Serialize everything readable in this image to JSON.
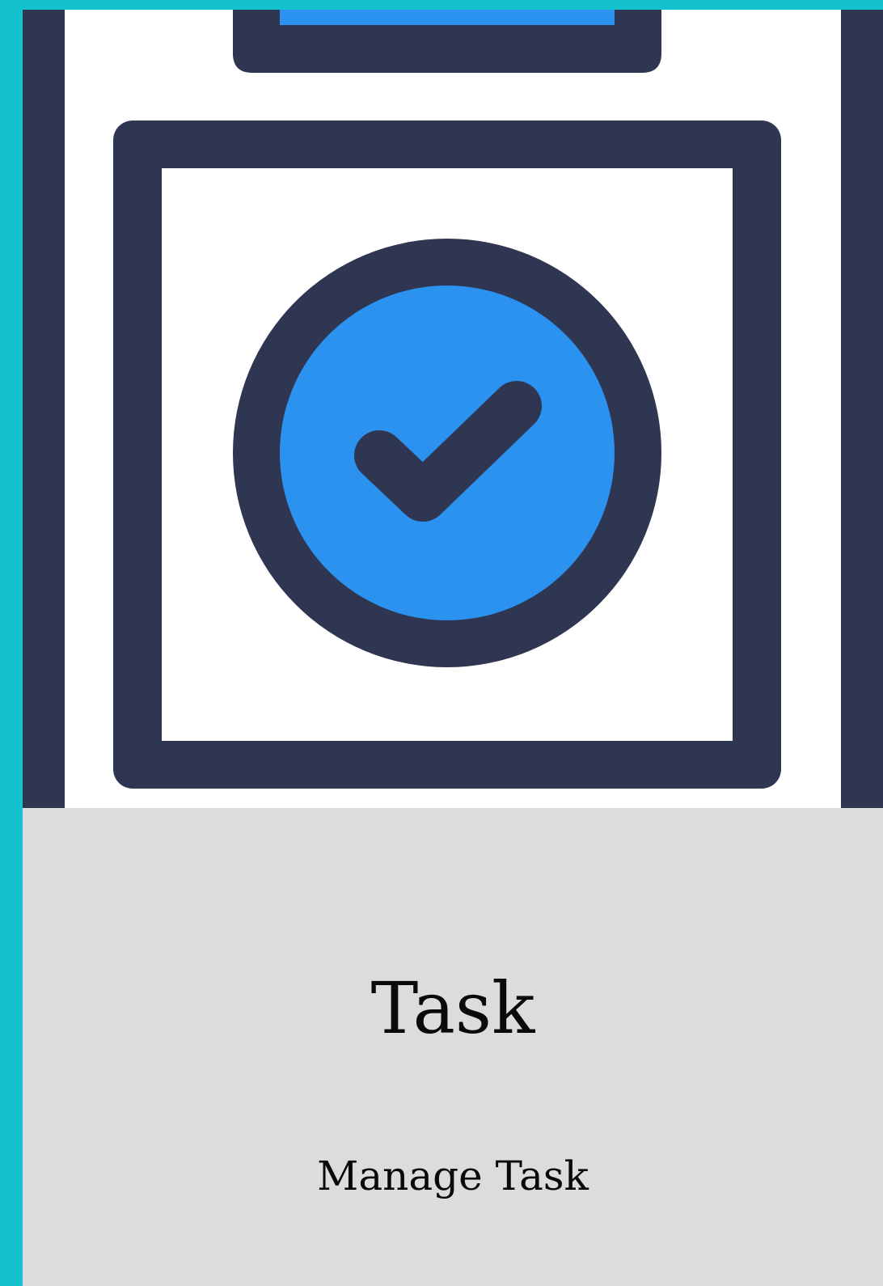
{
  "card": {
    "title": "Task",
    "subtitle": "Manage Task"
  },
  "illustration": {
    "icon": "task-check-icon",
    "colors": {
      "outline": "#2F3652",
      "fill": "#2B92F0",
      "background": "#FFFFFF"
    }
  },
  "colors": {
    "page_background": "#14C1CF",
    "caption_background": "#DCDCDC",
    "text": "#0A0A0A"
  }
}
